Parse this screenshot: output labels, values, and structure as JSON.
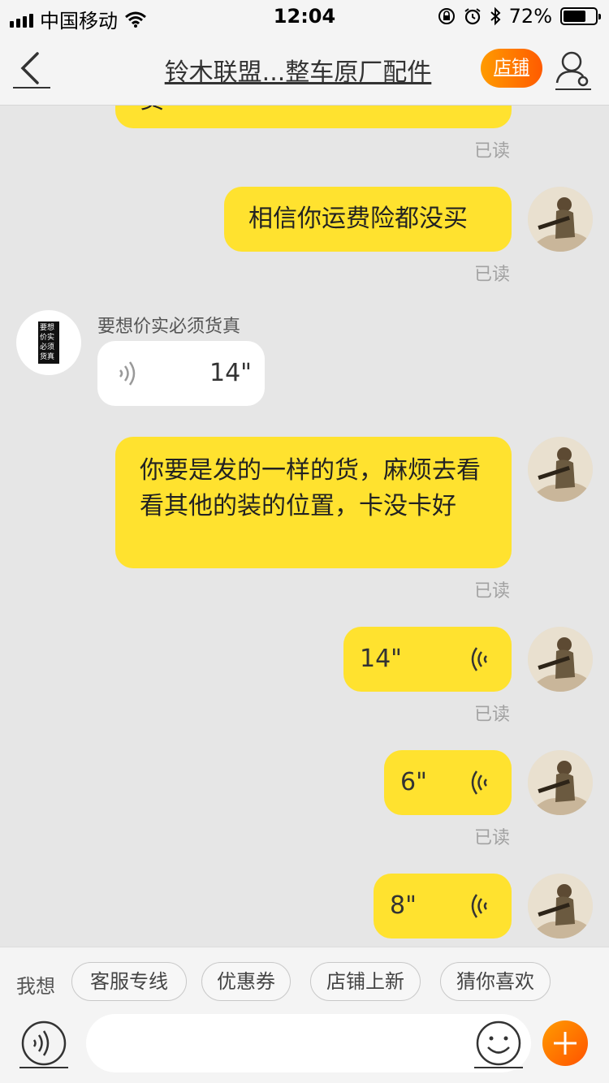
{
  "status": {
    "carrier": "中国移动",
    "time": "12:04",
    "battery": "72%",
    "battery_level": 0.72
  },
  "header": {
    "title": "铃木联盟...整车原厂配件",
    "shop_label": "店铺"
  },
  "messages": {
    "read_label": "已读",
    "m0_partial": "货",
    "m1_text": "相信你运费险都没买",
    "m2_sender": "要想价实必须货真",
    "m2_duration": "14\"",
    "m2_avatar_text": "要想价实必须货真",
    "m3_text": "你要是发的一样的货，麻烦去看看其他的装的位置，卡没卡好",
    "m4_duration": "14\"",
    "m5_duration": "6\"",
    "m6_duration": "8\""
  },
  "quickbar": {
    "label": "我想",
    "chips": [
      "客服专线",
      "优惠券",
      "店铺上新",
      "猜你喜欢"
    ]
  },
  "input": {
    "placeholder": ""
  },
  "colors": {
    "my_bubble": "#ffe22f",
    "accent_orange": "#ff6a00"
  },
  "icons": [
    "signal-icon",
    "wifi-icon",
    "lock-rotation-icon",
    "alarm-icon",
    "bluetooth-icon",
    "battery-icon",
    "back-icon",
    "user-settings-icon",
    "voice-wave-icon",
    "voice-toggle-icon",
    "emoji-icon",
    "plus-icon"
  ]
}
